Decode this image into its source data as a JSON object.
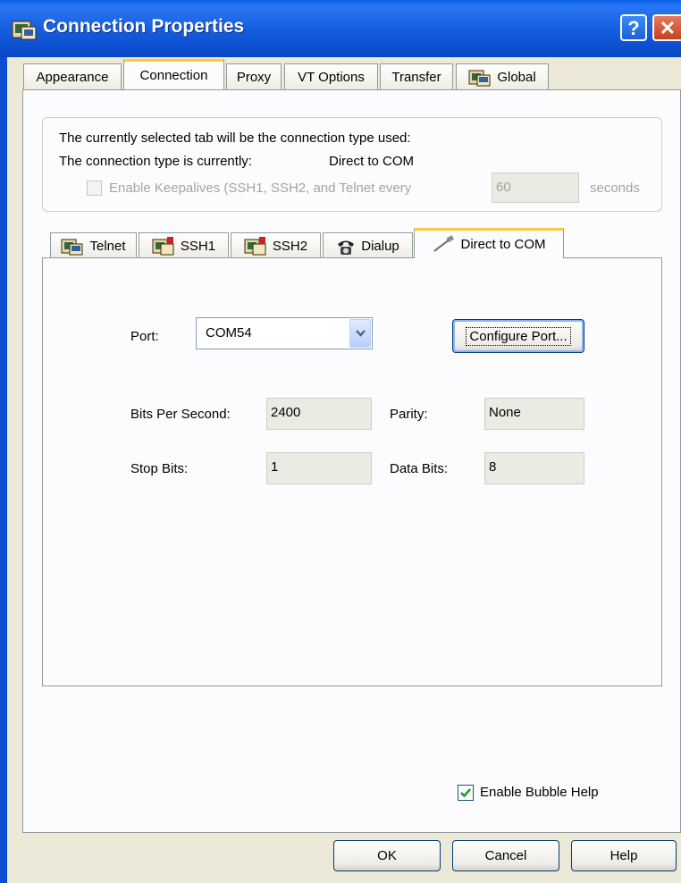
{
  "window": {
    "title": "Connection Properties",
    "help_label": "?",
    "close_label": "✕"
  },
  "outer_tabs": [
    {
      "label": "Appearance"
    },
    {
      "label": "Connection",
      "active": true
    },
    {
      "label": "Proxy"
    },
    {
      "label": "VT Options"
    },
    {
      "label": "Transfer"
    },
    {
      "label": "Global"
    }
  ],
  "connection": {
    "info_line1": "The currently selected tab will be the connection type used:",
    "info_line2_label": "The connection type is currently:",
    "current_type": "Direct to COM",
    "keepalive_label": "Enable Keepalives (SSH1, SSH2, and Telnet every",
    "keepalive_checked": false,
    "keepalive_value": "60",
    "keepalive_unit": "seconds"
  },
  "inner_tabs": [
    {
      "label": "Telnet"
    },
    {
      "label": "SSH1"
    },
    {
      "label": "SSH2"
    },
    {
      "label": "Dialup"
    },
    {
      "label": "Direct to COM",
      "active": true
    }
  ],
  "direct_com": {
    "port_label": "Port:",
    "port_value": "COM54",
    "configure_button": "Configure Port...",
    "bps_label": "Bits Per Second:",
    "bps_value": "2400",
    "parity_label": "Parity:",
    "parity_value": "None",
    "stopbits_label": "Stop Bits:",
    "stopbits_value": "1",
    "databits_label": "Data Bits:",
    "databits_value": "8"
  },
  "bubble_help": {
    "label": "Enable Bubble Help",
    "checked": true
  },
  "footer": {
    "ok": "OK",
    "cancel": "Cancel",
    "help": "Help"
  },
  "colors": {
    "titlebar": "#0a58e0",
    "active_tab_accent": "#ffc83c",
    "face": "#ece9d8",
    "check_green": "#21a121"
  }
}
